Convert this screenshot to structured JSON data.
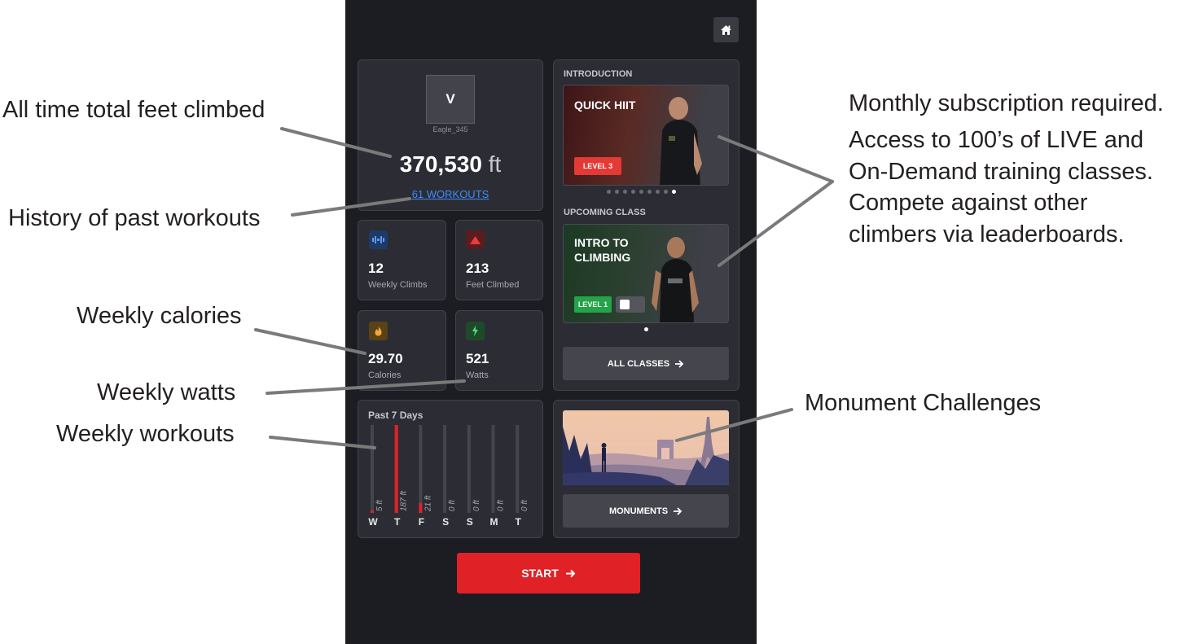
{
  "annotations": {
    "total_feet": "All time total feet climbed",
    "history": "History of past workouts",
    "calories": "Weekly calories",
    "watts": "Weekly watts",
    "workouts": "Weekly workouts",
    "subscription": [
      "Monthly subscription required.",
      "Access to 100’s of LIVE and",
      "On-Demand training classes.",
      "Compete against other",
      "climbers via leaderboards."
    ],
    "monuments": "Monument Challenges"
  },
  "profile": {
    "avatar_letter": "V",
    "username": "Eagle_345",
    "total_value": "370,530",
    "total_unit": "ft",
    "workouts_link": "61 WORKOUTS"
  },
  "stats": [
    {
      "value": "12",
      "label": "Weekly Climbs",
      "icon": "bars-icon",
      "color": "#3b82f6"
    },
    {
      "value": "213",
      "label": "Feet Climbed",
      "icon": "mountain-icon",
      "color": "#ef3a3a"
    },
    {
      "value": "29.70",
      "label": "Calories",
      "icon": "flame-icon",
      "color": "#e9a23b"
    },
    {
      "value": "521",
      "label": "Watts",
      "icon": "bolt-icon",
      "color": "#4ade80"
    }
  ],
  "classes": {
    "intro_label": "INTRODUCTION",
    "intro_title": "QUICK HIIT",
    "intro_level": "LEVEL 3",
    "intro_dots_total": 9,
    "intro_dots_active": 8,
    "upcoming_label": "UPCOMING CLASS",
    "upcoming_title_line1": "INTRO TO",
    "upcoming_title_line2": "CLIMBING",
    "upcoming_level": "LEVEL 1",
    "all_classes_label": "ALL CLASSES"
  },
  "monuments": {
    "button_label": "MONUMENTS"
  },
  "start_label": "START",
  "chart_data": {
    "type": "bar",
    "title": "Past 7 Days",
    "categories": [
      "W",
      "T",
      "F",
      "S",
      "S",
      "M",
      "T"
    ],
    "values": [
      5,
      187,
      21,
      0,
      0,
      0,
      0
    ],
    "value_labels": [
      "5 ft",
      "187 ft",
      "21 ft",
      "0 ft",
      "0 ft",
      "0 ft",
      "0 ft"
    ],
    "ylim": [
      0,
      187
    ],
    "bar_color": "#e02126",
    "track_color": "#45464d"
  },
  "colors": {
    "accent_red": "#e02126",
    "level1_green": "#22a447",
    "level3_red": "#e53935",
    "link_blue": "#3d8bfd"
  }
}
